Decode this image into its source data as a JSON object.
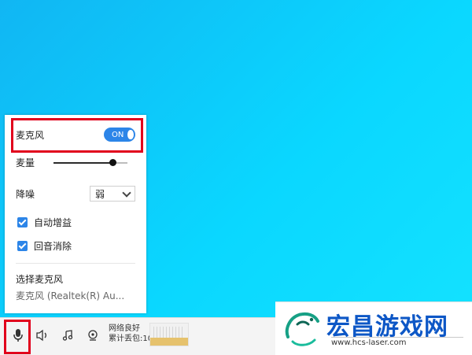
{
  "panel": {
    "mic_label": "麦克风",
    "toggle_label": "ON",
    "volume_label": "麦量",
    "volume_level": 0.8,
    "noise_label": "降噪",
    "noise_value": "弱",
    "auto_gain_label": "自动增益",
    "auto_gain_checked": true,
    "echo_label": "回音消除",
    "echo_checked": true,
    "select_mic_label": "选择麦克风",
    "selected_mic": "麦克风 (Realtek(R) Au..."
  },
  "bottom_bar": {
    "network_status": "网络良好",
    "packet_loss": "累计丢包:10"
  },
  "watermark": {
    "title": "宏昌游戏网",
    "url": "www.hcs-laser.com"
  },
  "colors": {
    "accent": "#2c85e8",
    "highlight": "#e1001c",
    "desktop": "#0ad7ff"
  }
}
